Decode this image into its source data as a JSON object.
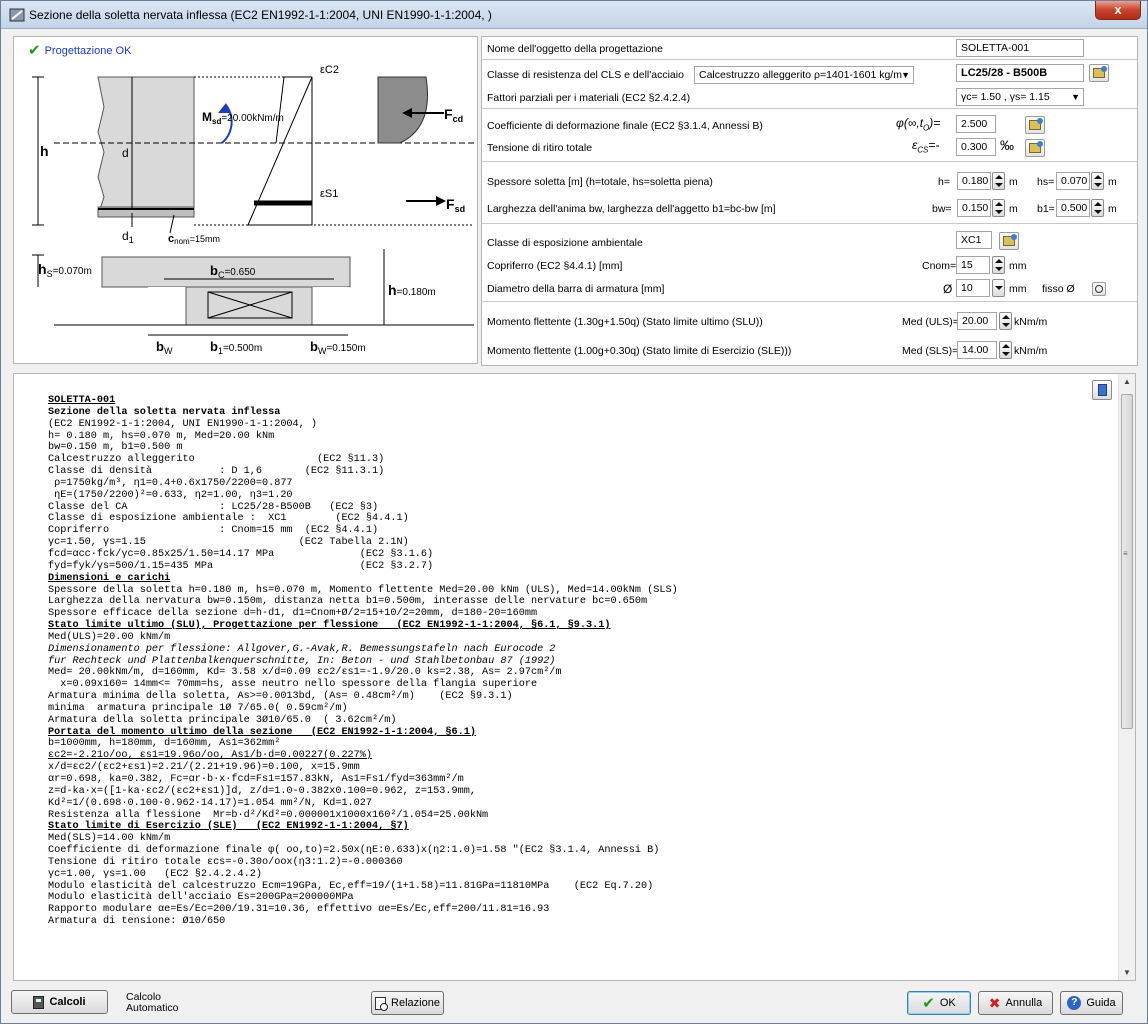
{
  "window": {
    "title": "Sezione della soletta nervata inflessa (EC2 EN1992-1-1:2004, UNI EN1990-1-1:2004, )",
    "close_label": "x"
  },
  "drawing": {
    "status": "Progettazione OK",
    "labels": {
      "ec2": "εC2",
      "es1": "εS1",
      "msd": "M",
      "msd_sub": "sd",
      "msd_val": "=20.00kNm/m",
      "fcd": "F",
      "fcd_sub": "cd",
      "fsd": "F",
      "fsd_sub": "sd",
      "h": "h",
      "d": "d",
      "d1": "d",
      "d1_sub": "1",
      "cnom": "c",
      "cnom_sub": "nom",
      "cnom_val": "=15mm",
      "hs": "h",
      "hs_sub": "S",
      "hs_val": "=0.070m",
      "bc": "b",
      "bc_sub": "C",
      "bc_val": "=0.650",
      "h2": "h",
      "h2_val": "=0.180m",
      "bw": "b",
      "bw_sub": "W",
      "b1": "b",
      "b1_sub": "1",
      "b1_val": "=0.500m",
      "bw2": "b",
      "bw2_sub": "W",
      "bw2_val": "=0.150m"
    }
  },
  "form": {
    "object_name_label": "Nome dell'oggetto della progettazione",
    "object_name_value": "SOLETTA-001",
    "class_label": "Classe di resistenza del CLS e dell'acciaio",
    "concrete_type": "Calcestruzzo alleggerito ρ=1401-1601 kg/m",
    "class_value": "LC25/28 - B500B",
    "partial_label": "Fattori parziali per i materiali (EC2 §2.4.2.4)",
    "partial_value": "γc= 1.50 , γs= 1.15",
    "creep_label": "Coefficiente di deformazione finale (EC2 §3.1.4, Annessi B)",
    "creep_symbol": "φ(∞,t",
    "creep_sub": "O",
    "creep_eq": ")=",
    "creep_value": "2.500",
    "shrink_label": "Tensione di ritiro totale",
    "shrink_symbol": "ε",
    "shrink_sub": "CS",
    "shrink_eq": "=-",
    "shrink_value": "0.300",
    "shrink_unit": "‰",
    "thick_label": "Spessore soletta [m] (h=totale, hs=soletta piena)",
    "h_label": "h=",
    "h_value": "0.180",
    "h_unit": "m",
    "hs_label": "hs=",
    "hs_value": "0.070",
    "hs_unit": "m",
    "width_label": "Larghezza dell'anima bw, larghezza dell'aggetto b1=bc-bw [m]",
    "bw_label": "bw=",
    "bw_value": "0.150",
    "bw_unit": "m",
    "b1_label": "b1=",
    "b1_value": "0.500",
    "b1_unit": "m",
    "exposure_label": "Classe di esposizione ambientale",
    "exposure_value": "XC1",
    "cover_label": "Copriferro (EC2 §4.4.1) [mm]",
    "cnom_label": "Cnom=",
    "cnom_value": "15",
    "cnom_unit": "mm",
    "bar_label": "Diametro della barra di armatura [mm]",
    "bar_symbol": "Ø",
    "bar_value": "10",
    "bar_unit": "mm",
    "fixed_label": "fisso Ø",
    "med_uls_label": "Momento flettente (1.30g+1.50q) (Stato limite ultimo (SLU))",
    "med_uls_prefix": "Med (ULS)=",
    "med_uls_value": "20.00",
    "med_uls_unit": "kNm/m",
    "med_sls_label": "Momento flettente (1.00g+0.30q) (Stato limite di Esercizio (SLE)))",
    "med_sls_prefix": "Med (SLS)=",
    "med_sls_value": "14.00",
    "med_sls_unit": "kNm/m"
  },
  "report": {
    "lines": [
      {
        "t": "SOLETTA-001",
        "s": "u"
      },
      {
        "t": "Sezione della soletta nervata inflessa",
        "s": "b"
      },
      {
        "t": "(EC2 EN1992-1-1:2004, UNI EN1990-1-1:2004, )",
        "s": ""
      },
      {
        "t": "h= 0.180 m, hs=0.070 m, Med=20.00 kNm",
        "s": ""
      },
      {
        "t": "bw=0.150 m, b1=0.500 m",
        "s": ""
      },
      {
        "t": "Calcestruzzo alleggerito                    (EC2 §11.3)",
        "s": ""
      },
      {
        "t": "Classe di densità           : D 1,6       (EC2 §11.3.1)",
        "s": ""
      },
      {
        "t": " ρ=1750kg/m³, η1=0.4+0.6x1750/2200=0.877",
        "s": ""
      },
      {
        "t": " ηE=(1750/2200)²=0.633, η2=1.00, η3=1.20",
        "s": ""
      },
      {
        "t": "Classe del CA               : LC25/28-B500B   (EC2 §3)",
        "s": ""
      },
      {
        "t": "Classe di esposizione ambientale :  XC1        (EC2 §4.4.1)",
        "s": ""
      },
      {
        "t": "Copriferro                  : Cnom=15 mm  (EC2 §4.4.1)",
        "s": ""
      },
      {
        "t": "γc=1.50, γs=1.15                         (EC2 Tabella 2.1N)",
        "s": ""
      },
      {
        "t": "fcd=αcc·fck/γc=0.85x25/1.50=14.17 MPa              (EC2 §3.1.6)",
        "s": ""
      },
      {
        "t": "fyd=fyk/γs=500/1.15=435 MPa                        (EC2 §3.2.7)",
        "s": ""
      },
      {
        "t": "Dimensioni e carichi",
        "s": "u"
      },
      {
        "t": "Spessore della soletta h=0.180 m, hs=0.070 m, Momento flettente Med=20.00 kNm (ULS), Med=14.00kNm (SLS)",
        "s": ""
      },
      {
        "t": "Larghezza della nervatura bw=0.150m, distanza netta b1=0.500m, interasse delle nervature bc=0.650m",
        "s": ""
      },
      {
        "t": "Spessore efficace della sezione d=h-d1, d1=Cnom+Ø/2=15+10/2=20mm, d=180-20=160mm",
        "s": ""
      },
      {
        "t": "Stato limite ultimo (SLU), Progettazione per flessione   (EC2 EN1992-1-1:2004, §6.1, §9.3.1)",
        "s": "u"
      },
      {
        "t": "Med(ULS)=20.00 kNm/m",
        "s": ""
      },
      {
        "t": "Dimensionamento per flessione: Allgover,G.-Avak,R. Bemessungstafeln nach Eurocode 2",
        "s": "i"
      },
      {
        "t": "fur Rechteck und Plattenbalkenquerschnitte, In: Beton - und Stahlbetonbau 87 (1992)",
        "s": "i"
      },
      {
        "t": "Med= 20.00kNm/m, d=160mm, Kd= 3.58 x/d=0.09 εc2/εs1=-1.9/20.0 ks=2.38, As= 2.97cm²/m",
        "s": ""
      },
      {
        "t": "  x=0.09x160= 14mm<= 70mm=hs, asse neutro nello spessore della flangia superiore",
        "s": ""
      },
      {
        "t": "Armatura minima della soletta, As>=0.0013bd, (As= 0.48cm²/m)    (EC2 §9.3.1)",
        "s": ""
      },
      {
        "t": "minima  armatura principale 1Ø 7/65.0( 0.59cm²/m)",
        "s": ""
      },
      {
        "t": "Armatura della soletta principale 3Ø10/65.0  ( 3.62cm²/m)",
        "s": ""
      },
      {
        "t": "Portata del momento ultimo della sezione   (EC2 EN1992-1-1:2004, §6.1)",
        "s": "u"
      },
      {
        "t": "b=1000mm, h=180mm, d=160mm, As1=362mm²",
        "s": ""
      },
      {
        "t": "εc2=-2.21o/oo, εs1=19.96o/oo, As1/b·d=0.00227(0.227%)",
        "s": "ul"
      },
      {
        "t": "x/d=εc2/(εc2+εs1)=2.21/(2.21+19.96)=0.100, x=15.9mm",
        "s": ""
      },
      {
        "t": "αr=0.698, ka=0.382, Fc=αr·b·x·fcd=Fs1=157.83kN, As1=Fs1/fyd=363mm²/m",
        "s": ""
      },
      {
        "t": "z=d-ka·x=([1-ka·εc2/(εc2+εs1)]d, z/d=1.0-0.382x0.100=0.962, z=153.9mm,",
        "s": ""
      },
      {
        "t": "Kd²=1/(0.698·0.100·0.962·14.17)=1.054 mm²/N, Kd=1.027",
        "s": ""
      },
      {
        "t": "Resistenza alla flessione  Mr=b·d²/Kd²=0.000001x1000x160²/1.054=25.00kNm",
        "s": ""
      },
      {
        "t": "Stato limite di Esercizio (SLE)   (EC2 EN1992-1-1:2004, §7)",
        "s": "u"
      },
      {
        "t": "Med(SLS)=14.00 kNm/m",
        "s": ""
      },
      {
        "t": "Coefficiente di deformazione finale φ( oo,to)=2.50x(ηE:0.633)x(η2:1.0)=1.58 \"(EC2 §3.1.4, Annessi B)",
        "s": ""
      },
      {
        "t": "Tensione di ritiro totale εcs=-0.30o/oox(η3:1.2)=-0.000360",
        "s": ""
      },
      {
        "t": "γc=1.00, γs=1.00   (EC2 §2.4.2.4.2)",
        "s": ""
      },
      {
        "t": "Modulo elasticità del calcestruzzo Ecm=19GPa, Ec,eff=19/(1+1.58)=11.81GPa=11810MPa    (EC2 Eq.7.20)",
        "s": ""
      },
      {
        "t": "Modulo elasticità dell'acciaio Es=200GPa=200000MPa",
        "s": ""
      },
      {
        "t": "Rapporto modulare αe=Es/Ec=200/19.31=10.36, effettivo αe=Es/Ec,eff=200/11.81=16.93",
        "s": ""
      },
      {
        "t": "Armatura di tensione: Ø10/650",
        "s": ""
      }
    ]
  },
  "buttons": {
    "calcoli": "Calcoli",
    "auto": "Calcolo",
    "auto2": "Automatico",
    "relazione": "Relazione",
    "ok": "OK",
    "annulla": "Annulla",
    "guida": "Guida"
  }
}
